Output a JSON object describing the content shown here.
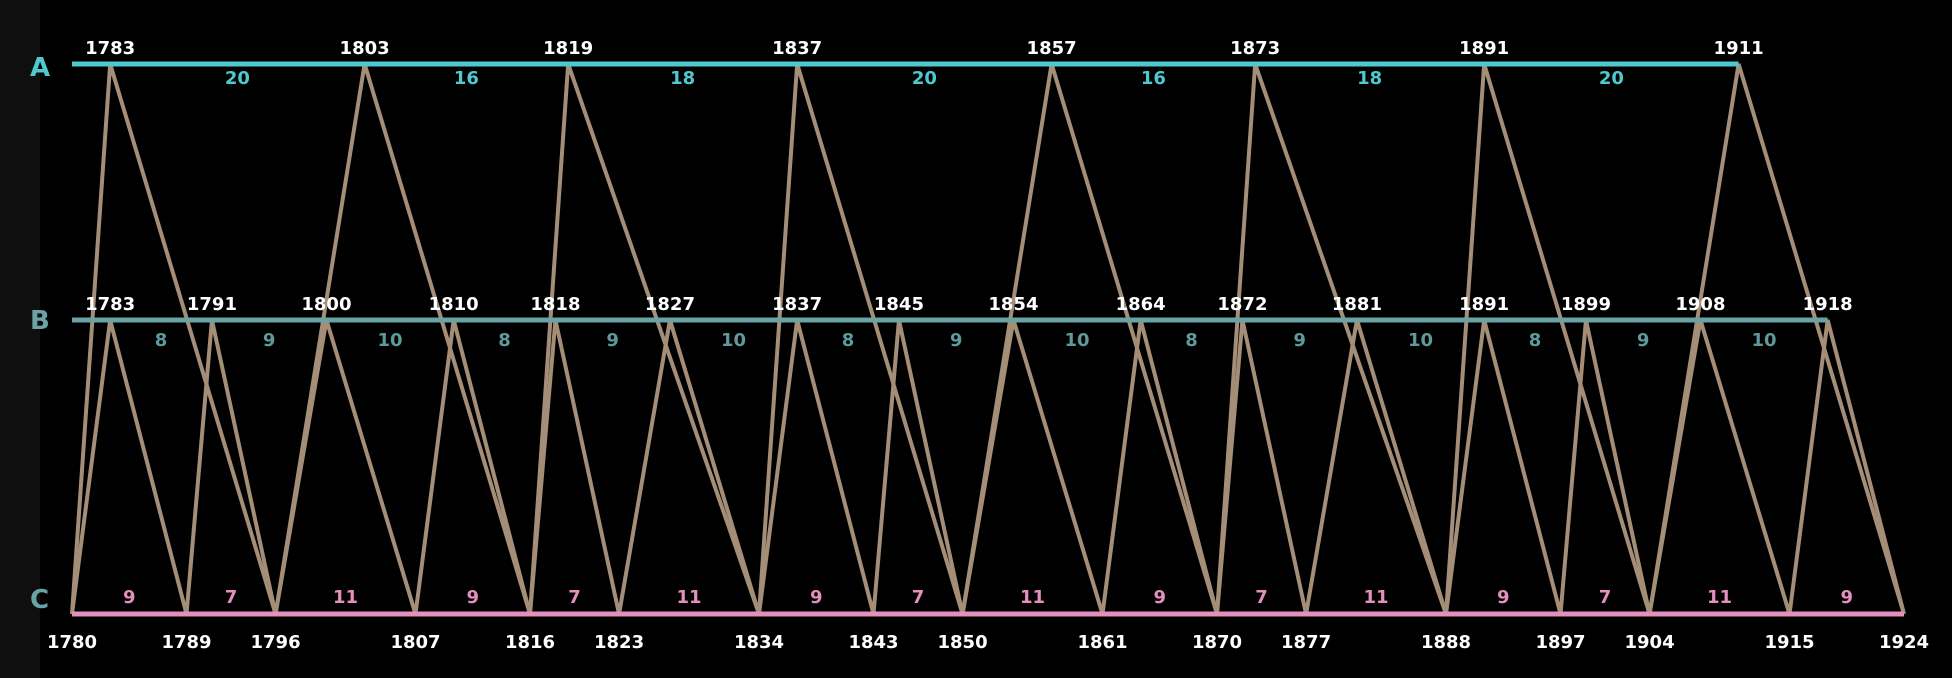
{
  "colors": {
    "background": "#0f0f0f",
    "plot_background": "#000000",
    "row_a": "#4ec9cf",
    "row_b": "#6aa3a5",
    "row_c": "#e48fbe",
    "zigzag": "#a48e77",
    "year_text": "#ffffff"
  },
  "rows": [
    {
      "id": "A",
      "label": "A",
      "years": [
        1783,
        1803,
        1819,
        1837,
        1857,
        1873,
        1891,
        1911
      ],
      "gaps": [
        20,
        16,
        18,
        20,
        16,
        18,
        20
      ]
    },
    {
      "id": "B",
      "label": "B",
      "years": [
        1783,
        1791,
        1800,
        1810,
        1818,
        1827,
        1837,
        1845,
        1854,
        1864,
        1872,
        1881,
        1891,
        1899,
        1908,
        1918
      ],
      "gaps": [
        8,
        9,
        10,
        8,
        9,
        10,
        8,
        9,
        10,
        8,
        9,
        10,
        8,
        9,
        10
      ]
    },
    {
      "id": "C",
      "label": "C",
      "years": [
        1780,
        1789,
        1796,
        1807,
        1816,
        1823,
        1834,
        1843,
        1850,
        1861,
        1870,
        1877,
        1888,
        1897,
        1904,
        1915,
        1924
      ],
      "gaps": [
        9,
        7,
        11,
        9,
        7,
        11,
        9,
        7,
        11,
        9,
        7,
        11,
        9,
        7,
        11,
        9
      ]
    }
  ]
}
